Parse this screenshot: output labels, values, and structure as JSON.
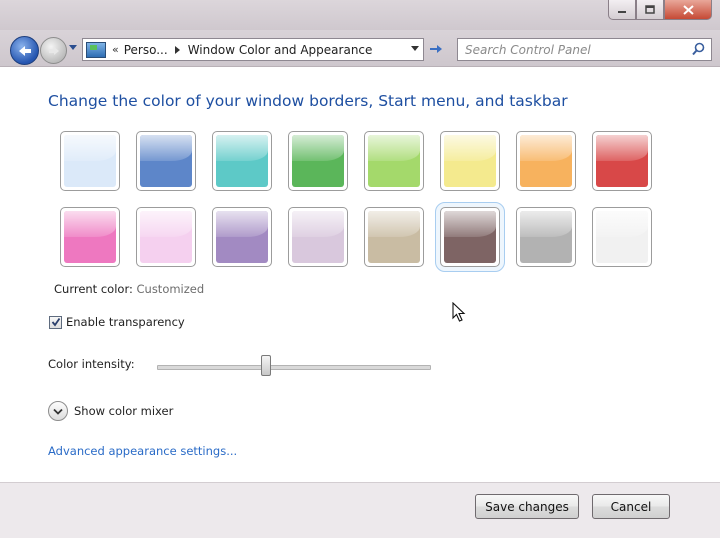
{
  "window": {
    "caption_buttons": [
      "minimize",
      "maximize",
      "close"
    ]
  },
  "navbar": {
    "breadcrumb": {
      "overflow_glyph": "«",
      "items": [
        "Perso...",
        "Window Color and Appearance"
      ]
    },
    "search_placeholder": "Search Control Panel"
  },
  "main": {
    "heading": "Change the color of your window borders, Start menu, and taskbar",
    "swatches": [
      {
        "name": "sky",
        "color": "#dbe9f9"
      },
      {
        "name": "twilight",
        "color": "#5d86c9"
      },
      {
        "name": "sea",
        "color": "#5dc9c7"
      },
      {
        "name": "leaf",
        "color": "#5bb65a"
      },
      {
        "name": "lime",
        "color": "#a4d96b"
      },
      {
        "name": "lemon",
        "color": "#f4ea8e"
      },
      {
        "name": "pumpkin",
        "color": "#f7b25e"
      },
      {
        "name": "ruby",
        "color": "#d84848"
      },
      {
        "name": "fuchsia",
        "color": "#ee78c0"
      },
      {
        "name": "blush",
        "color": "#f5d0ef"
      },
      {
        "name": "violet",
        "color": "#a28ac2"
      },
      {
        "name": "lavender",
        "color": "#d9c8dd"
      },
      {
        "name": "taupe",
        "color": "#c9bca3"
      },
      {
        "name": "chocolate",
        "color": "#7e6464"
      },
      {
        "name": "slate",
        "color": "#b2b2b2"
      },
      {
        "name": "frost",
        "color": "#f1f1f1"
      }
    ],
    "selected_swatch_index": 13,
    "current_color_label": "Current color:",
    "current_color_value": "Customized",
    "enable_transparency_label": "Enable transparency",
    "enable_transparency_checked": true,
    "color_intensity_label": "Color intensity:",
    "color_intensity_fraction": 0.4,
    "show_color_mixer_label": "Show color mixer",
    "advanced_link": "Advanced appearance settings..."
  },
  "footer": {
    "save_label": "Save changes",
    "cancel_label": "Cancel"
  }
}
